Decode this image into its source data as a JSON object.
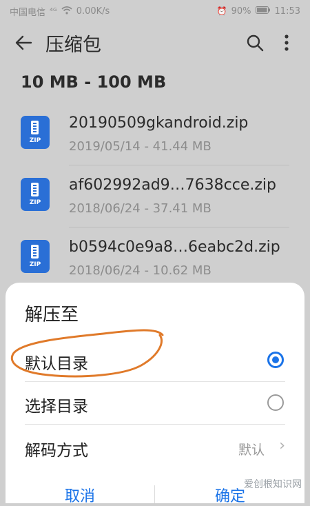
{
  "status_bar": {
    "carrier": "中国电信",
    "signal": "⁴ᴳ",
    "speed": "0.00K/s",
    "alarm": "⏰",
    "battery_pct": "90%",
    "time": "11:53"
  },
  "header": {
    "title": "压缩包"
  },
  "section": {
    "title": "10 MB - 100 MB"
  },
  "files": [
    {
      "name": "20190509gkandroid.zip",
      "meta": "2019/05/14 - 41.44 MB"
    },
    {
      "name": "af602992ad9…7638cce.zip",
      "meta": "2018/06/24 - 37.41 MB"
    },
    {
      "name": "b0594c0e9a8…6eabc2d.zip",
      "meta": "2018/06/24 - 10.62 MB"
    }
  ],
  "file_icon_label": "ZIP",
  "sheet": {
    "title": "解压至",
    "options": [
      {
        "label": "默认目录",
        "selected": true
      },
      {
        "label": "选择目录",
        "selected": false
      }
    ],
    "decode": {
      "label": "解码方式",
      "value": "默认"
    },
    "buttons": {
      "cancel": "取消",
      "confirm": "确定"
    }
  },
  "watermark": "爱创根知识网",
  "colors": {
    "accent": "#1a73e8",
    "icon_blue": "#2a6fd6",
    "scribble": "#e07a2a"
  }
}
